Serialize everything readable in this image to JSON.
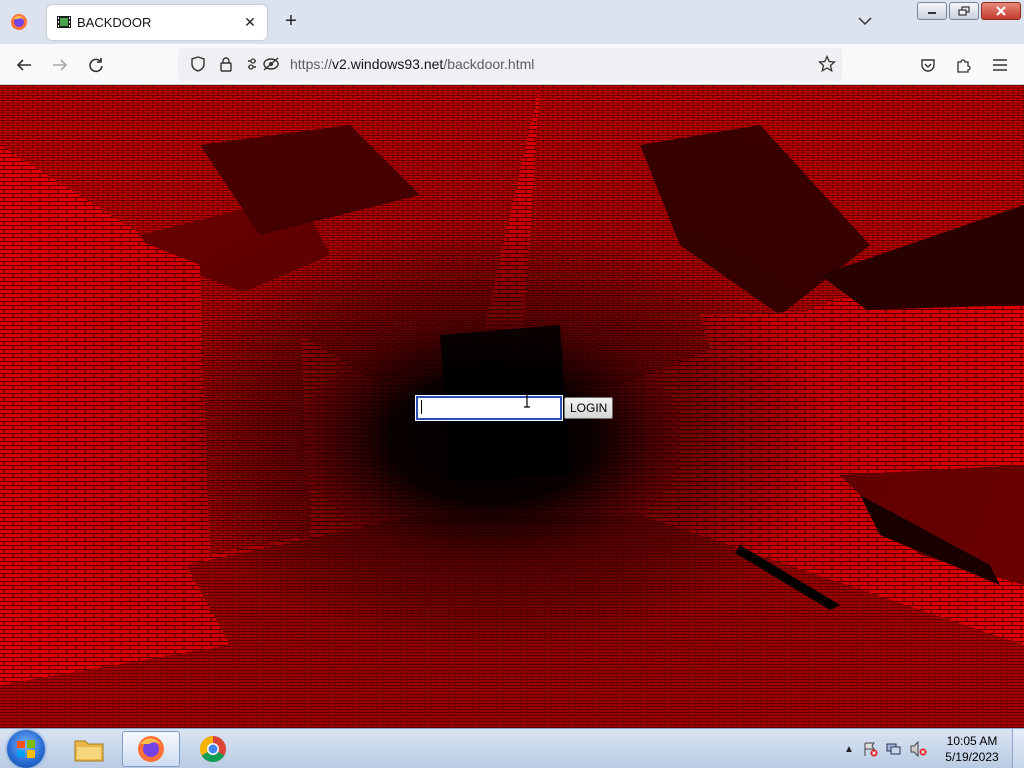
{
  "browser": {
    "tab": {
      "title": "BACKDOOR"
    },
    "url": {
      "scheme": "https://",
      "host": "v2.windows93.net",
      "path": "/backdoor.html"
    },
    "icons": [
      "firefox-menu-icon",
      "film-icon",
      "close-icon",
      "plus-icon",
      "chevron-down-icon",
      "back-icon",
      "forward-icon",
      "reload-icon",
      "shield-icon",
      "lock-icon",
      "permissions-icon",
      "star-icon",
      "pocket-icon",
      "extensions-icon",
      "hamburger-icon"
    ]
  },
  "page": {
    "login": {
      "input_value": "",
      "button_label": "LOGIN"
    },
    "colors": {
      "brick": "#c80000",
      "void": "#000000"
    }
  },
  "taskbar": {
    "clock": {
      "time": "10:05 AM",
      "date": "5/19/2023"
    },
    "apps": [
      "file-explorer",
      "firefox",
      "chrome"
    ]
  }
}
